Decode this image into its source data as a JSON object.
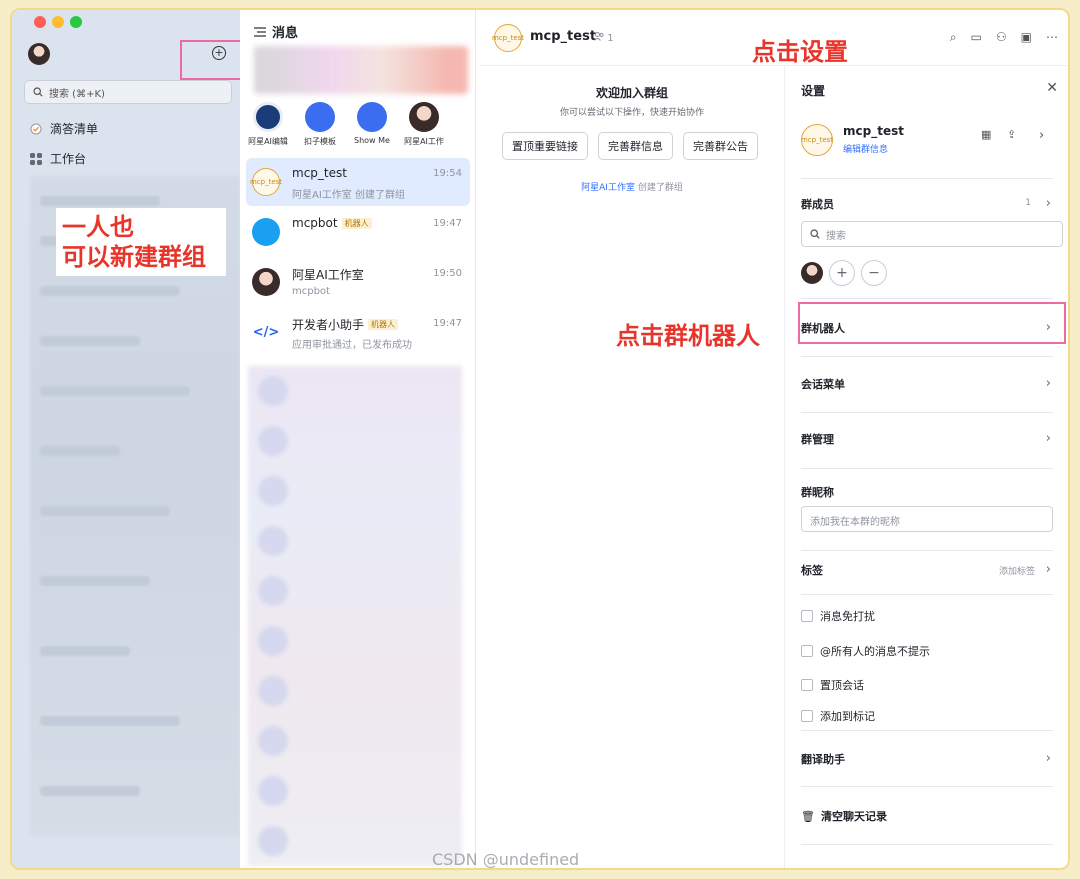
{
  "sidebar": {
    "search_placeholder": "搜索 (⌘+K)",
    "items": [
      {
        "label": "滴答清单",
        "icon": "check-circle-icon"
      },
      {
        "label": "工作台",
        "icon": "grid-icon"
      }
    ]
  },
  "annotations": {
    "left": [
      "一人也",
      "可以新建群组"
    ],
    "top": "点击设置",
    "mid": "点击群机器人"
  },
  "messages": {
    "title": "消息",
    "bots": [
      {
        "label": "阿星AI编辑"
      },
      {
        "label": "扣子模板"
      },
      {
        "label": "Show Me"
      },
      {
        "label": "阿星AI工作"
      }
    ],
    "conversations": [
      {
        "name": "mcp_test",
        "sub": "阿星AI工作室 创建了群组",
        "time": "19:54",
        "tag": ""
      },
      {
        "name": "mcpbot",
        "sub": "",
        "time": "19:47",
        "tag": "机器人"
      },
      {
        "name": "阿星AI工作室",
        "sub": "mcpbot",
        "time": "19:50",
        "tag": ""
      },
      {
        "name": "开发者小助手",
        "sub": "应用审批通过，已发布成功",
        "time": "19:47",
        "tag": "机器人"
      }
    ]
  },
  "chat": {
    "avatar_text": [
      "mcp_",
      "test"
    ],
    "title": "mcp_test",
    "member_count": "1",
    "welcome_title": "欢迎加入群组",
    "welcome_sub": "你可以尝试以下操作，快速开始协作",
    "buttons": [
      "置顶重要链接",
      "完善群信息",
      "完善群公告"
    ],
    "creator_name": "阿星AI工作室",
    "creator_action": "创建了群组"
  },
  "settings": {
    "title": "设置",
    "group_name": "mcp_test",
    "edit_info": "编辑群信息",
    "members_label": "群成员",
    "members_count": "1",
    "search_placeholder": "搜索",
    "group_bot": "群机器人",
    "session_menu": "会话菜单",
    "group_manage": "群管理",
    "group_nickname": "群昵称",
    "nickname_placeholder": "添加我在本群的昵称",
    "tags": "标签",
    "add_tag": "添加标签",
    "checks": [
      "消息免打扰",
      "@所有人的消息不提示",
      "置顶会话",
      "添加到标记"
    ],
    "translate": "翻译助手",
    "clear_history": "清空聊天记录"
  },
  "watermark": "CSDN @undefined",
  "colors": {
    "accent": "#3370ff",
    "annotation": "#e8352b",
    "highlight": "#ef6aa3"
  }
}
